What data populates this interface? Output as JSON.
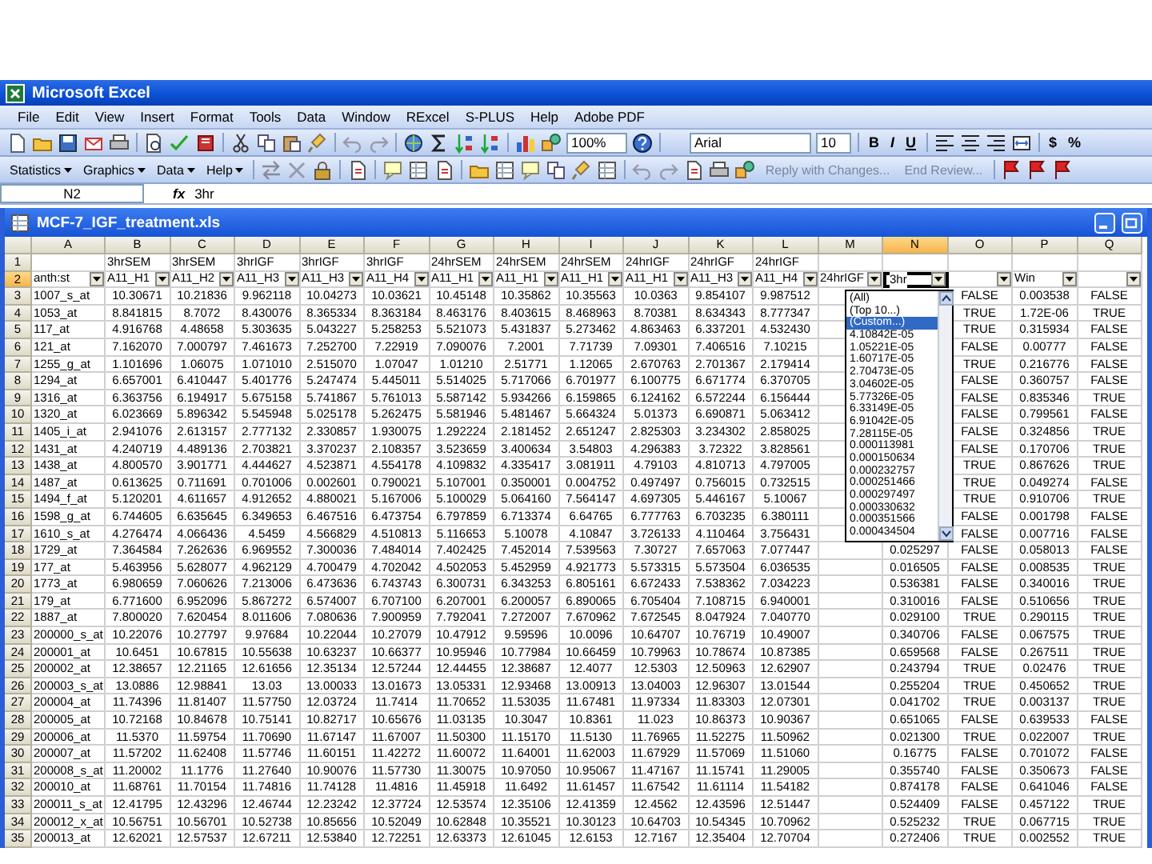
{
  "window": {
    "title": "Microsoft Excel"
  },
  "menus": [
    {
      "label": "File"
    },
    {
      "label": "Edit"
    },
    {
      "label": "View"
    },
    {
      "label": "Insert"
    },
    {
      "label": "Format"
    },
    {
      "label": "Tools"
    },
    {
      "label": "Data"
    },
    {
      "label": "Window"
    },
    {
      "label": "RExcel"
    },
    {
      "label": "S-PLUS"
    },
    {
      "label": "Help"
    },
    {
      "label": "Adobe PDF"
    }
  ],
  "toolbar": {
    "zoom": "100%",
    "font": "Arial",
    "font_size": "10",
    "bold": "B",
    "italic": "I",
    "underline": "U",
    "currency": "$",
    "percent": "%"
  },
  "toolbar2": {
    "menus": [
      "Statistics",
      "Graphics",
      "Data",
      "Help"
    ],
    "review": [
      "Reply with Changes...",
      "End Review..."
    ]
  },
  "formula_bar": {
    "name_box": "N2",
    "fx": "fx",
    "value": "3hr"
  },
  "workbook": {
    "title": "MCF-7_IGF_treatment.xls"
  },
  "sheet": {
    "columns": [
      {
        "label": "A",
        "selected": false
      },
      {
        "label": "B",
        "selected": false
      },
      {
        "label": "C",
        "selected": false
      },
      {
        "label": "D",
        "selected": false
      },
      {
        "label": "E",
        "selected": false
      },
      {
        "label": "F",
        "selected": false
      },
      {
        "label": "G",
        "selected": false
      },
      {
        "label": "H",
        "selected": false
      },
      {
        "label": "I",
        "selected": false
      },
      {
        "label": "J",
        "selected": false
      },
      {
        "label": "K",
        "selected": false
      },
      {
        "label": "L",
        "selected": false
      },
      {
        "label": "M",
        "selected": false
      },
      {
        "label": "N",
        "selected": true
      },
      {
        "label": "O",
        "selected": false
      },
      {
        "label": "P",
        "selected": false
      },
      {
        "label": "Q",
        "selected": false
      }
    ],
    "header_row": {
      "number": "1",
      "selected": false,
      "labels": [
        "3hrSEM",
        "3hrSEM",
        "3hrIGF",
        "3hrIGF",
        "3hrIGF",
        "24hrSEM",
        "24hrSEM",
        "24hrSEM",
        "24hrIGF",
        "24hrIGF",
        "24hrIGF"
      ]
    },
    "filter_row": {
      "number": "2",
      "selected": true,
      "filters": [
        {
          "value": "anth:st",
          "dropdown": true
        },
        {
          "value": "A11_H1",
          "dropdown": true
        },
        {
          "value": "A11_H2",
          "dropdown": true
        },
        {
          "value": "A11_H3",
          "dropdown": true
        },
        {
          "value": "A11_H3",
          "dropdown": true
        },
        {
          "value": "A11_H4",
          "dropdown": true
        },
        {
          "value": "A11_H1",
          "dropdown": true
        },
        {
          "value": "A11_H1",
          "dropdown": true
        },
        {
          "value": "A11_H1",
          "dropdown": true
        },
        {
          "value": "A11_H1",
          "dropdown": true
        },
        {
          "value": "A11_H3",
          "dropdown": true
        },
        {
          "value": "A11_H4",
          "dropdown": true
        },
        {
          "value": "24hrIGF",
          "dropdown": true
        },
        {
          "value": "3hr",
          "dropdown": true
        },
        {
          "dropdown": true
        },
        {
          "value": "Win",
          "dropdown": true
        },
        {
          "dropdown": true
        }
      ]
    },
    "rows": [
      {
        "number": "3",
        "selected": false,
        "cells": [
          "1007_s_at",
          "10.30671",
          "10.21836",
          "9.962118",
          "10.04273",
          "10.03621",
          "10.45148",
          "10.35862",
          "10.35563",
          "10.0363",
          "9.854107",
          "9.987512"
        ],
        "o": "FALSE",
        "p": "0.003538",
        "q": "FALSE"
      },
      {
        "number": "4",
        "selected": false,
        "cells": [
          "1053_at",
          "8.841815",
          "8.7072",
          "8.430076",
          "8.365334",
          "8.363184",
          "8.463176",
          "8.403615",
          "8.468963",
          "8.70381",
          "8.634343",
          "8.777347"
        ],
        "o": "TRUE",
        "p": "1.72E-06",
        "q": "TRUE"
      },
      {
        "number": "5",
        "selected": false,
        "cells": [
          "117_at",
          "4.916768",
          "4.48658",
          "5.303635",
          "5.043227",
          "5.258253",
          "5.521073",
          "5.431837",
          "5.273462",
          "4.863463",
          "6.337201",
          "4.532430"
        ],
        "o": "TRUE",
        "p": "0.315934",
        "q": "FALSE"
      },
      {
        "number": "6",
        "selected": false,
        "cells": [
          "121_at",
          "7.162070",
          "7.000797",
          "7.461673",
          "7.252700",
          "7.22919",
          "7.090076",
          "7.2001",
          "7.71739",
          "7.09301",
          "7.406516",
          "7.10215"
        ],
        "o": "FALSE",
        "p": "0.00777",
        "q": "FALSE"
      },
      {
        "number": "7",
        "selected": false,
        "cells": [
          "1255_g_at",
          "1.101696",
          "1.06075",
          "1.071010",
          "2.515070",
          "1.07047",
          "1.01210",
          "2.51771",
          "1.12065",
          "2.670763",
          "2.701367",
          "2.179414"
        ],
        "o": "TRUE",
        "p": "0.216776",
        "q": "FALSE"
      },
      {
        "number": "8",
        "selected": false,
        "cells": [
          "1294_at",
          "6.657001",
          "6.410447",
          "5.401776",
          "5.247474",
          "5.445011",
          "5.514025",
          "5.717066",
          "6.701977",
          "6.100775",
          "6.671774",
          "6.370705"
        ],
        "o": "FALSE",
        "p": "0.360757",
        "q": "FALSE"
      },
      {
        "number": "9",
        "selected": false,
        "cells": [
          "1316_at",
          "6.363756",
          "6.194917",
          "5.675158",
          "5.741867",
          "5.761013",
          "5.587142",
          "5.934266",
          "6.159865",
          "6.124162",
          "6.572244",
          "6.156444"
        ],
        "o": "FALSE",
        "p": "0.835346",
        "q": "TRUE"
      },
      {
        "number": "10",
        "selected": false,
        "cells": [
          "1320_at",
          "6.023669",
          "5.896342",
          "5.545948",
          "5.025178",
          "5.262475",
          "5.581946",
          "5.481467",
          "5.664324",
          "5.01373",
          "6.690871",
          "5.063412"
        ],
        "o": "FALSE",
        "p": "0.799561",
        "q": "FALSE"
      },
      {
        "number": "11",
        "selected": false,
        "cells": [
          "1405_i_at",
          "2.941076",
          "2.613157",
          "2.777132",
          "2.330857",
          "1.930075",
          "1.292224",
          "2.181452",
          "2.651247",
          "2.825303",
          "3.234302",
          "2.858025"
        ],
        "o": "FALSE",
        "p": "0.324856",
        "q": "TRUE"
      },
      {
        "number": "12",
        "selected": false,
        "cells": [
          "1431_at",
          "4.240719",
          "4.489136",
          "2.703821",
          "3.370237",
          "2.108357",
          "3.523659",
          "3.400634",
          "3.54803",
          "4.296383",
          "3.72322",
          "3.828561"
        ],
        "o": "FALSE",
        "p": "0.170706",
        "q": "TRUE"
      },
      {
        "number": "13",
        "selected": false,
        "cells": [
          "1438_at",
          "4.800570",
          "3.901771",
          "4.444627",
          "4.523871",
          "4.554178",
          "4.109832",
          "4.335417",
          "3.081911",
          "4.79103",
          "4.810713",
          "4.797005"
        ],
        "o": "TRUE",
        "p": "0.867626",
        "q": "TRUE"
      },
      {
        "number": "14",
        "selected": false,
        "cells": [
          "1487_at",
          "0.613625",
          "0.711691",
          "0.701006",
          "0.002601",
          "0.790021",
          "5.107001",
          "0.350001",
          "0.004752",
          "0.497497",
          "0.756015",
          "0.732515"
        ],
        "o": "TRUE",
        "p": "0.049274",
        "q": "FALSE"
      },
      {
        "number": "15",
        "selected": false,
        "cells": [
          "1494_f_at",
          "5.120201",
          "4.611657",
          "4.912652",
          "4.880021",
          "5.167006",
          "5.100029",
          "5.064160",
          "7.564147",
          "4.697305",
          "5.446167",
          "5.10067"
        ],
        "o": "TRUE",
        "p": "0.910706",
        "q": "TRUE"
      },
      {
        "number": "16",
        "selected": false,
        "cells": [
          "1598_g_at",
          "6.744605",
          "6.635645",
          "6.349653",
          "6.467516",
          "6.473754",
          "6.797859",
          "6.713374",
          "6.64765",
          "6.777763",
          "6.703235",
          "6.380111"
        ],
        "o": "FALSE",
        "p": "0.001798",
        "q": "FALSE"
      },
      {
        "number": "17",
        "selected": false,
        "cells": [
          "1610_s_at",
          "4.276474",
          "4.066436",
          "4.5459",
          "4.566829",
          "4.510813",
          "5.116653",
          "5.10078",
          "4.10847",
          "3.726133",
          "4.110464",
          "3.756431"
        ],
        "o": "FALSE",
        "p": "0.007716",
        "q": "FALSE"
      },
      {
        "number": "18",
        "selected": false,
        "cells": [
          "1729_at",
          "7.364584",
          "7.262636",
          "6.969552",
          "7.300036",
          "7.484014",
          "7.402425",
          "7.452014",
          "7.539563",
          "7.30727",
          "7.657063",
          "7.077447"
        ],
        "n": "0.025297",
        "o": "FALSE",
        "p": "0.058013",
        "q": "FALSE"
      },
      {
        "number": "19",
        "selected": false,
        "cells": [
          "177_at",
          "5.463956",
          "5.628077",
          "4.962129",
          "4.700479",
          "4.702042",
          "4.502053",
          "5.452959",
          "4.921773",
          "5.573315",
          "5.573504",
          "6.036535"
        ],
        "n": "0.016505",
        "o": "FALSE",
        "p": "0.008535",
        "q": "TRUE"
      },
      {
        "number": "20",
        "selected": false,
        "cells": [
          "1773_at",
          "6.980659",
          "7.060626",
          "7.213006",
          "6.473636",
          "6.743743",
          "6.300731",
          "6.343253",
          "6.805161",
          "6.672433",
          "7.538362",
          "7.034223"
        ],
        "n": "0.536381",
        "o": "FALSE",
        "p": "0.340016",
        "q": "TRUE"
      },
      {
        "number": "21",
        "selected": false,
        "cells": [
          "179_at",
          "6.771600",
          "6.952096",
          "5.867272",
          "6.574007",
          "6.707100",
          "6.207001",
          "6.200057",
          "6.890065",
          "6.705404",
          "7.108715",
          "6.940001"
        ],
        "n": "0.310016",
        "o": "FALSE",
        "p": "0.510656",
        "q": "TRUE"
      },
      {
        "number": "22",
        "selected": false,
        "cells": [
          "1887_at",
          "7.800020",
          "7.620454",
          "8.011606",
          "7.080636",
          "7.900959",
          "7.792041",
          "7.272007",
          "7.670962",
          "7.672545",
          "8.047924",
          "7.040770"
        ],
        "n": "0.029100",
        "o": "TRUE",
        "p": "0.290115",
        "q": "TRUE"
      },
      {
        "number": "23",
        "selected": false,
        "cells": [
          "200000_s_at",
          "10.22076",
          "10.27797",
          "9.97684",
          "10.22044",
          "10.27079",
          "10.47912",
          "9.59596",
          "10.0096",
          "10.64707",
          "10.76719",
          "10.49007"
        ],
        "n": "0.340706",
        "o": "FALSE",
        "p": "0.067575",
        "q": "TRUE"
      },
      {
        "number": "24",
        "selected": false,
        "cells": [
          "200001_at",
          "10.6451",
          "10.67815",
          "10.55638",
          "10.63237",
          "10.66377",
          "10.95946",
          "10.77984",
          "10.66459",
          "10.79963",
          "10.78674",
          "10.87385"
        ],
        "n": "0.659568",
        "o": "FALSE",
        "p": "0.267511",
        "q": "TRUE"
      },
      {
        "number": "25",
        "selected": false,
        "cells": [
          "200002_at",
          "12.38657",
          "12.21165",
          "12.61656",
          "12.35134",
          "12.57244",
          "12.44455",
          "12.38687",
          "12.4077",
          "12.5303",
          "12.50963",
          "12.62907"
        ],
        "n": "0.243794",
        "o": "TRUE",
        "p": "0.02476",
        "q": "TRUE"
      },
      {
        "number": "26",
        "selected": false,
        "cells": [
          "200003_s_at",
          "13.0886",
          "12.98841",
          "13.03",
          "13.00033",
          "13.01673",
          "13.05331",
          "12.93468",
          "13.00913",
          "13.04003",
          "12.96307",
          "13.01544"
        ],
        "n": "0.255204",
        "o": "TRUE",
        "p": "0.450652",
        "q": "TRUE"
      },
      {
        "number": "27",
        "selected": false,
        "cells": [
          "200004_at",
          "11.74396",
          "11.81407",
          "11.57750",
          "12.03724",
          "11.7414",
          "11.70652",
          "11.53035",
          "11.67481",
          "11.97334",
          "11.83303",
          "12.07301"
        ],
        "n": "0.041702",
        "o": "TRUE",
        "p": "0.003137",
        "q": "TRUE"
      },
      {
        "number": "28",
        "selected": false,
        "cells": [
          "200005_at",
          "10.72168",
          "10.84678",
          "10.75141",
          "10.82717",
          "10.65676",
          "11.03135",
          "10.3047",
          "10.8361",
          "11.023",
          "10.86373",
          "10.90367"
        ],
        "n": "0.651065",
        "o": "FALSE",
        "p": "0.639533",
        "q": "FALSE"
      },
      {
        "number": "29",
        "selected": false,
        "cells": [
          "200006_at",
          "11.5370",
          "11.59754",
          "11.70690",
          "11.67147",
          "11.67007",
          "11.50300",
          "11.15170",
          "11.5130",
          "11.76965",
          "11.52275",
          "11.50962"
        ],
        "n": "0.021300",
        "o": "TRUE",
        "p": "0.022007",
        "q": "TRUE"
      },
      {
        "number": "30",
        "selected": false,
        "cells": [
          "200007_at",
          "11.57202",
          "11.62408",
          "11.57746",
          "11.60151",
          "11.42272",
          "11.60072",
          "11.64001",
          "11.62003",
          "11.67929",
          "11.57069",
          "11.51060"
        ],
        "n": "0.16775",
        "o": "FALSE",
        "p": "0.701072",
        "q": "FALSE"
      },
      {
        "number": "31",
        "selected": false,
        "cells": [
          "200008_s_at",
          "11.20002",
          "11.1776",
          "11.27640",
          "10.90076",
          "11.57730",
          "11.30075",
          "10.97050",
          "10.95067",
          "11.47167",
          "11.15741",
          "11.29005"
        ],
        "n": "0.355740",
        "o": "FALSE",
        "p": "0.350673",
        "q": "FALSE"
      },
      {
        "number": "32",
        "selected": false,
        "cells": [
          "200010_at",
          "11.68761",
          "11.70154",
          "11.74816",
          "11.74128",
          "11.4816",
          "11.45918",
          "11.6492",
          "11.61457",
          "11.67542",
          "11.61114",
          "11.54182"
        ],
        "n": "0.874178",
        "o": "FALSE",
        "p": "0.641046",
        "q": "FALSE"
      },
      {
        "number": "33",
        "selected": false,
        "cells": [
          "200011_s_at",
          "12.41795",
          "12.43296",
          "12.46744",
          "12.23242",
          "12.37724",
          "12.53574",
          "12.35106",
          "12.41359",
          "12.4562",
          "12.43596",
          "12.51447"
        ],
        "n": "0.524409",
        "o": "FALSE",
        "p": "0.457122",
        "q": "TRUE"
      },
      {
        "number": "34",
        "selected": false,
        "cells": [
          "200012_x_at",
          "10.56751",
          "10.56701",
          "10.52738",
          "10.85656",
          "10.52049",
          "10.62848",
          "10.35521",
          "10.30123",
          "10.64703",
          "10.54345",
          "10.70962"
        ],
        "n": "0.525232",
        "o": "TRUE",
        "p": "0.067715",
        "q": "TRUE"
      },
      {
        "number": "35",
        "selected": false,
        "cells": [
          "200013_at",
          "12.62021",
          "12.57537",
          "12.67211",
          "12.53840",
          "12.72251",
          "12.63373",
          "12.61045",
          "12.6153",
          "12.7167",
          "12.35404",
          "12.70704"
        ],
        "n": "0.272406",
        "o": "TRUE",
        "p": "0.002552",
        "q": "TRUE"
      }
    ]
  },
  "dropdown": {
    "items": [
      {
        "label": "(All)",
        "selected": false
      },
      {
        "label": "(Top 10...)",
        "selected": false
      },
      {
        "label": "(Custom...)",
        "selected": true
      },
      {
        "label": "4.10842E-05",
        "selected": false
      },
      {
        "label": "1.05221E-05",
        "selected": false
      },
      {
        "label": "1.60717E-05",
        "selected": false
      },
      {
        "label": "2.70473E-05",
        "selected": false
      },
      {
        "label": "3.04602E-05",
        "selected": false
      },
      {
        "label": "5.77326E-05",
        "selected": false
      },
      {
        "label": "6.33149E-05",
        "selected": false
      },
      {
        "label": "6.91042E-05",
        "selected": false
      },
      {
        "label": "7.28115E-05",
        "selected": false
      },
      {
        "label": "0.000113981",
        "selected": false
      },
      {
        "label": "0.000150634",
        "selected": false
      },
      {
        "label": "0.000232757",
        "selected": false
      },
      {
        "label": "0.000251466",
        "selected": false
      },
      {
        "label": "0.000297497",
        "selected": false
      },
      {
        "label": "0.000330632",
        "selected": false
      },
      {
        "label": "0.000351566",
        "selected": false
      },
      {
        "label": "0.000434504",
        "selected": false
      }
    ]
  }
}
